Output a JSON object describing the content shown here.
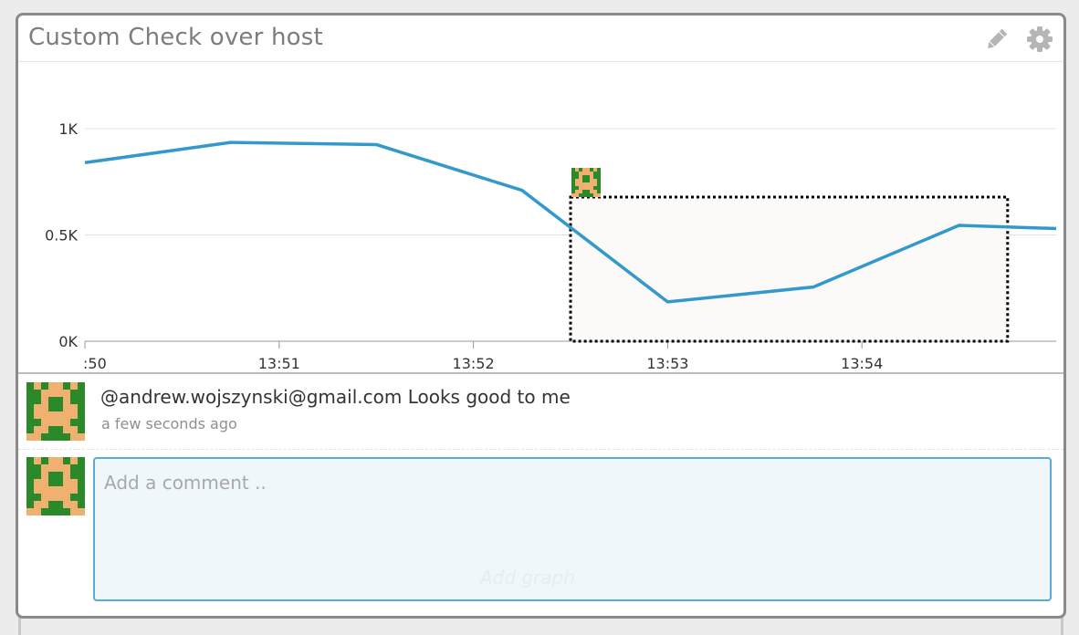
{
  "widget": {
    "title": "Custom Check over host",
    "icons": [
      "pencil-icon",
      "gear-icon"
    ]
  },
  "chart_data": {
    "type": "line",
    "x": [
      "13:50:00",
      "13:50:45",
      "13:51:30",
      "13:52:15",
      "13:53:00",
      "13:53:45",
      "13:54:30",
      "13:55:00"
    ],
    "series": [
      {
        "values": [
          840,
          935,
          925,
          710,
          185,
          255,
          545,
          530
        ],
        "color": "#3399cc"
      }
    ],
    "xticks": [
      ":50",
      "13:51",
      "13:52",
      "13:53",
      "13:54"
    ],
    "yticks": [
      "0K",
      "0.5K",
      "1K"
    ],
    "ylim": [
      0,
      1000
    ],
    "grid": true,
    "selection": {
      "from": "13:52:30",
      "to": "13:54:45"
    }
  },
  "comments": [
    {
      "text": "@andrew.wojszynski@gmail.com Looks good to me",
      "time": "a few seconds ago"
    }
  ],
  "new_comment": {
    "placeholder": "Add a comment ..",
    "value": ""
  },
  "ghost_label": "Add graph",
  "colors": {
    "line": "#3399cc",
    "input_border": "#5aa9d9",
    "avatar_bg": "#2a8a2a",
    "avatar_face": "#f0b070"
  }
}
